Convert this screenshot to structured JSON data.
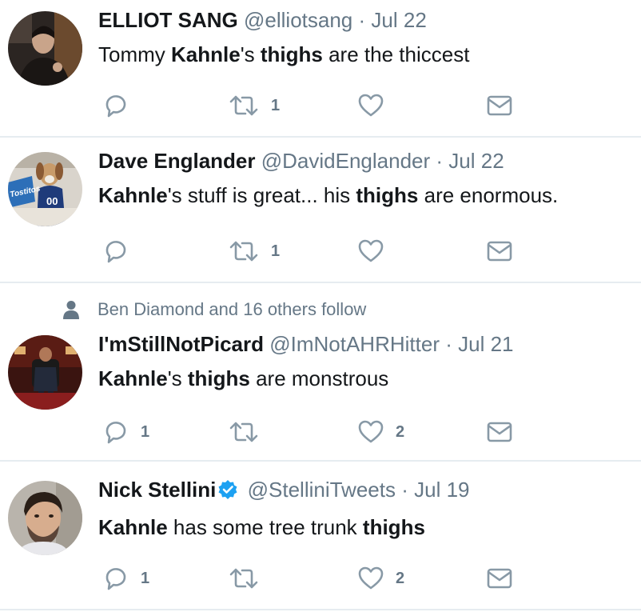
{
  "tweets": [
    {
      "name": "ELLIOT SANG",
      "handle": "@elliotsang",
      "date": "Jul 22",
      "text": [
        {
          "t": "Tommy ",
          "b": false
        },
        {
          "t": "Kahnle",
          "b": true
        },
        {
          "t": "'s ",
          "b": false
        },
        {
          "t": "thighs",
          "b": true
        },
        {
          "t": " are the thiccest",
          "b": false
        }
      ],
      "reply_count": "",
      "retweet_count": "1",
      "like_count": ""
    },
    {
      "name": "Dave Englander",
      "handle": "@DavidEnglander",
      "date": "Jul 22",
      "text": [
        {
          "t": "Kahnle",
          "b": true
        },
        {
          "t": "'s stuff is great... his ",
          "b": false
        },
        {
          "t": "thighs",
          "b": true
        },
        {
          "t": " are enormous.",
          "b": false
        }
      ],
      "reply_count": "",
      "retweet_count": "1",
      "like_count": "",
      "avatar_text": [
        "Tostitos",
        "00"
      ]
    },
    {
      "social_context": "Ben Diamond and 16 others follow",
      "name": "I'mStillNotPicard",
      "handle": "@ImNotAHRHitter",
      "date": "Jul 21",
      "text": [
        {
          "t": "Kahnle",
          "b": true
        },
        {
          "t": "'s ",
          "b": false
        },
        {
          "t": "thighs",
          "b": true
        },
        {
          "t": " are monstrous",
          "b": false
        }
      ],
      "reply_count": "1",
      "retweet_count": "",
      "like_count": "2"
    },
    {
      "name": "Nick Stellini",
      "verified": true,
      "handle": "@StelliniTweets",
      "date": "Jul 19",
      "text": [
        {
          "t": "Kahnle",
          "b": true
        },
        {
          "t": " has some tree trunk ",
          "b": false
        },
        {
          "t": "thighs",
          "b": true
        }
      ],
      "reply_count": "1",
      "retweet_count": "",
      "like_count": "2"
    }
  ],
  "dot_separator": "·",
  "icons": {
    "reply": "reply-icon",
    "retweet": "retweet-icon",
    "like": "heart-icon",
    "dm": "envelope-icon",
    "social": "person-icon",
    "verified": "verified-badge-icon"
  },
  "colors": {
    "text": "#14171a",
    "secondary": "#657786",
    "icon": "#8899a6",
    "divider": "#e6ecf0",
    "verified": "#1da1f2"
  }
}
